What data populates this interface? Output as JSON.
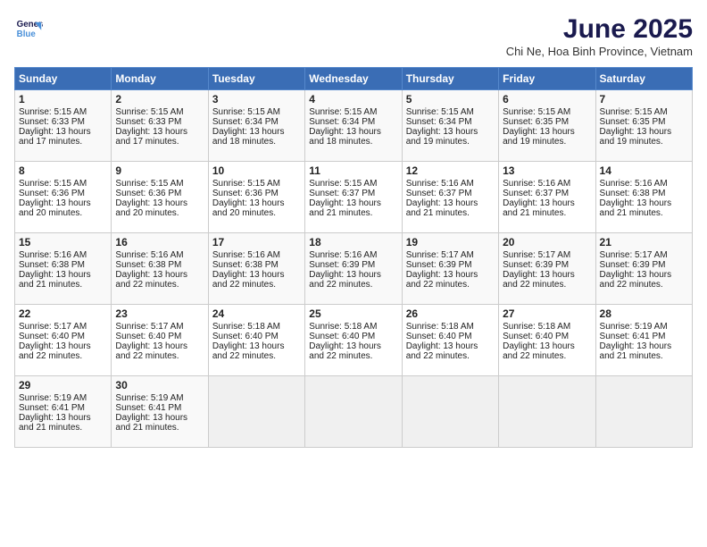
{
  "logo": {
    "line1": "General",
    "line2": "Blue"
  },
  "title": "June 2025",
  "subtitle": "Chi Ne, Hoa Binh Province, Vietnam",
  "weekdays": [
    "Sunday",
    "Monday",
    "Tuesday",
    "Wednesday",
    "Thursday",
    "Friday",
    "Saturday"
  ],
  "weeks": [
    [
      {
        "day": "1",
        "rise": "5:15 AM",
        "set": "6:33 PM",
        "daylight": "13 hours and 17 minutes."
      },
      {
        "day": "2",
        "rise": "5:15 AM",
        "set": "6:33 PM",
        "daylight": "13 hours and 17 minutes."
      },
      {
        "day": "3",
        "rise": "5:15 AM",
        "set": "6:34 PM",
        "daylight": "13 hours and 18 minutes."
      },
      {
        "day": "4",
        "rise": "5:15 AM",
        "set": "6:34 PM",
        "daylight": "13 hours and 18 minutes."
      },
      {
        "day": "5",
        "rise": "5:15 AM",
        "set": "6:34 PM",
        "daylight": "13 hours and 19 minutes."
      },
      {
        "day": "6",
        "rise": "5:15 AM",
        "set": "6:35 PM",
        "daylight": "13 hours and 19 minutes."
      },
      {
        "day": "7",
        "rise": "5:15 AM",
        "set": "6:35 PM",
        "daylight": "13 hours and 19 minutes."
      }
    ],
    [
      {
        "day": "8",
        "rise": "5:15 AM",
        "set": "6:36 PM",
        "daylight": "13 hours and 20 minutes."
      },
      {
        "day": "9",
        "rise": "5:15 AM",
        "set": "6:36 PM",
        "daylight": "13 hours and 20 minutes."
      },
      {
        "day": "10",
        "rise": "5:15 AM",
        "set": "6:36 PM",
        "daylight": "13 hours and 20 minutes."
      },
      {
        "day": "11",
        "rise": "5:15 AM",
        "set": "6:37 PM",
        "daylight": "13 hours and 21 minutes."
      },
      {
        "day": "12",
        "rise": "5:16 AM",
        "set": "6:37 PM",
        "daylight": "13 hours and 21 minutes."
      },
      {
        "day": "13",
        "rise": "5:16 AM",
        "set": "6:37 PM",
        "daylight": "13 hours and 21 minutes."
      },
      {
        "day": "14",
        "rise": "5:16 AM",
        "set": "6:38 PM",
        "daylight": "13 hours and 21 minutes."
      }
    ],
    [
      {
        "day": "15",
        "rise": "5:16 AM",
        "set": "6:38 PM",
        "daylight": "13 hours and 21 minutes."
      },
      {
        "day": "16",
        "rise": "5:16 AM",
        "set": "6:38 PM",
        "daylight": "13 hours and 22 minutes."
      },
      {
        "day": "17",
        "rise": "5:16 AM",
        "set": "6:38 PM",
        "daylight": "13 hours and 22 minutes."
      },
      {
        "day": "18",
        "rise": "5:16 AM",
        "set": "6:39 PM",
        "daylight": "13 hours and 22 minutes."
      },
      {
        "day": "19",
        "rise": "5:17 AM",
        "set": "6:39 PM",
        "daylight": "13 hours and 22 minutes."
      },
      {
        "day": "20",
        "rise": "5:17 AM",
        "set": "6:39 PM",
        "daylight": "13 hours and 22 minutes."
      },
      {
        "day": "21",
        "rise": "5:17 AM",
        "set": "6:39 PM",
        "daylight": "13 hours and 22 minutes."
      }
    ],
    [
      {
        "day": "22",
        "rise": "5:17 AM",
        "set": "6:40 PM",
        "daylight": "13 hours and 22 minutes."
      },
      {
        "day": "23",
        "rise": "5:17 AM",
        "set": "6:40 PM",
        "daylight": "13 hours and 22 minutes."
      },
      {
        "day": "24",
        "rise": "5:18 AM",
        "set": "6:40 PM",
        "daylight": "13 hours and 22 minutes."
      },
      {
        "day": "25",
        "rise": "5:18 AM",
        "set": "6:40 PM",
        "daylight": "13 hours and 22 minutes."
      },
      {
        "day": "26",
        "rise": "5:18 AM",
        "set": "6:40 PM",
        "daylight": "13 hours and 22 minutes."
      },
      {
        "day": "27",
        "rise": "5:18 AM",
        "set": "6:40 PM",
        "daylight": "13 hours and 22 minutes."
      },
      {
        "day": "28",
        "rise": "5:19 AM",
        "set": "6:41 PM",
        "daylight": "13 hours and 21 minutes."
      }
    ],
    [
      {
        "day": "29",
        "rise": "5:19 AM",
        "set": "6:41 PM",
        "daylight": "13 hours and 21 minutes."
      },
      {
        "day": "30",
        "rise": "5:19 AM",
        "set": "6:41 PM",
        "daylight": "13 hours and 21 minutes."
      },
      null,
      null,
      null,
      null,
      null
    ]
  ]
}
